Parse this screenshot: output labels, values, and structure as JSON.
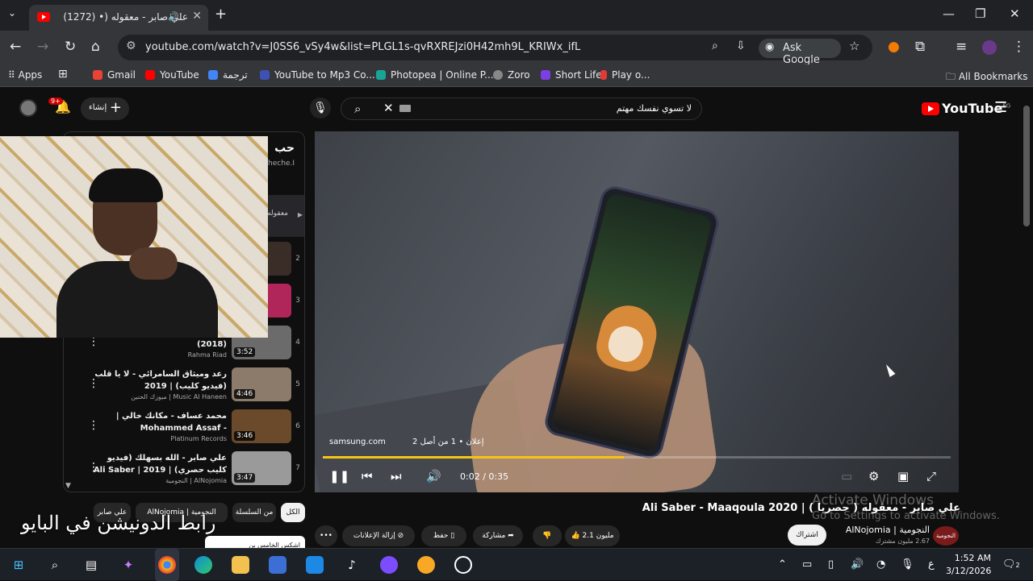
{
  "browser": {
    "tab_title": "علي صابر - معقوله (• (1272)",
    "tab_close": "✕",
    "new_tab": "+",
    "url": "youtube.com/watch?v=J0SS6_vSy4w&list=PLGL1s-qvRXREJzi0H42mh9L_KRIWx_ifL",
    "ask_google": "Ask Google",
    "window_controls": [
      "—",
      "❐",
      "✕"
    ]
  },
  "bookmarks": {
    "apps": "Apps",
    "items": [
      {
        "label": "Gmail",
        "color": "#ea4335"
      },
      {
        "label": "YouTube",
        "color": "#ff0000"
      },
      {
        "label": "ترجمة",
        "color": "#4285f4"
      },
      {
        "label": "YouTube to Mp3 Co...",
        "color": "#3f51b5"
      },
      {
        "label": "Photopea | Online P...",
        "color": "#18a497"
      },
      {
        "label": "Zoro",
        "color": "#888888"
      },
      {
        "label": "Short Life",
        "color": "#7b3fe4"
      },
      {
        "label": "Play o...",
        "color": "#e53935"
      }
    ],
    "all_bookmarks": "All Bookmarks"
  },
  "youtube": {
    "logo_text": "YouTube",
    "region": "EG",
    "search_query": "لا تسوي نفسك مهتم",
    "create_label": "إنشاء",
    "notif_badge": "9+",
    "player": {
      "ad_site": "samsung.com",
      "ad_meta": "إعلان • 1 من أصل 2",
      "time": "0:02 / 0:35",
      "progress": 0.48
    },
    "video_title": "علي صابر - معقوله ( حصريا ) | Ali Saber - Maaqoula 2020",
    "channel_name": "النجومية | AlNojomia",
    "channel_subs": "2.67 مليون مشترك",
    "channel_avatar": "النجومية",
    "subscribe": "اشتراك",
    "actions": {
      "like": "2.1 مليون",
      "share": "مشاركة",
      "save": "حفظ",
      "remove_ads": "إزالة الإعلانات",
      "more": "•••"
    },
    "chips": [
      "الكل",
      "من السلسلة",
      "AlNojomia | النجومية",
      "علي صابر"
    ],
    "overlay_text": "رابط الدونيشن في البايو",
    "activate": "Activate Windows",
    "activate_sub": "Go to Settings to activate Windows.",
    "playlist": {
      "title": "حب",
      "subtitle": "cheche.I",
      "active_snippet": "معقوله",
      "items": [
        {
          "idx": "2",
          "title": "",
          "channel": "",
          "duration": "",
          "thumb": "#3a2c26"
        },
        {
          "idx": "3",
          "title": "",
          "channel": "",
          "duration": "",
          "thumb": "#b0255a"
        },
        {
          "idx": "4",
          "title": "../ [Official Lyric Video] (2018)",
          "channel": "Rahma Riad",
          "duration": "3:52",
          "thumb": "#6b6b6b"
        },
        {
          "idx": "5",
          "title": "رعد وميثاق السامرائي - لا يا قلب (فيديو كليب) | 2019",
          "channel": "Music Al Haneen | ميوزك الحنين",
          "duration": "4:46",
          "thumb": "#8c7a6a"
        },
        {
          "idx": "6",
          "title": "محمد عساف - مكانك خالي | Mohammed Assaf - Makanak..",
          "channel": "Platinum Records",
          "duration": "3:46",
          "thumb": "#6a4a2a"
        },
        {
          "idx": "7",
          "title": "علي صابر - الله بسهلك (فيديو كليب حصري) | 2019 | Ali Saber -..",
          "channel": "AlNojomia | النجومية",
          "duration": "3:47",
          "thumb": "#9a9a9a"
        }
      ]
    },
    "recommend_snippet": "اشكس الخامس بن"
  },
  "taskbar": {
    "time": "1:52 AM",
    "date": "3/12/2026",
    "lang": "ع",
    "notif_count": "2"
  }
}
